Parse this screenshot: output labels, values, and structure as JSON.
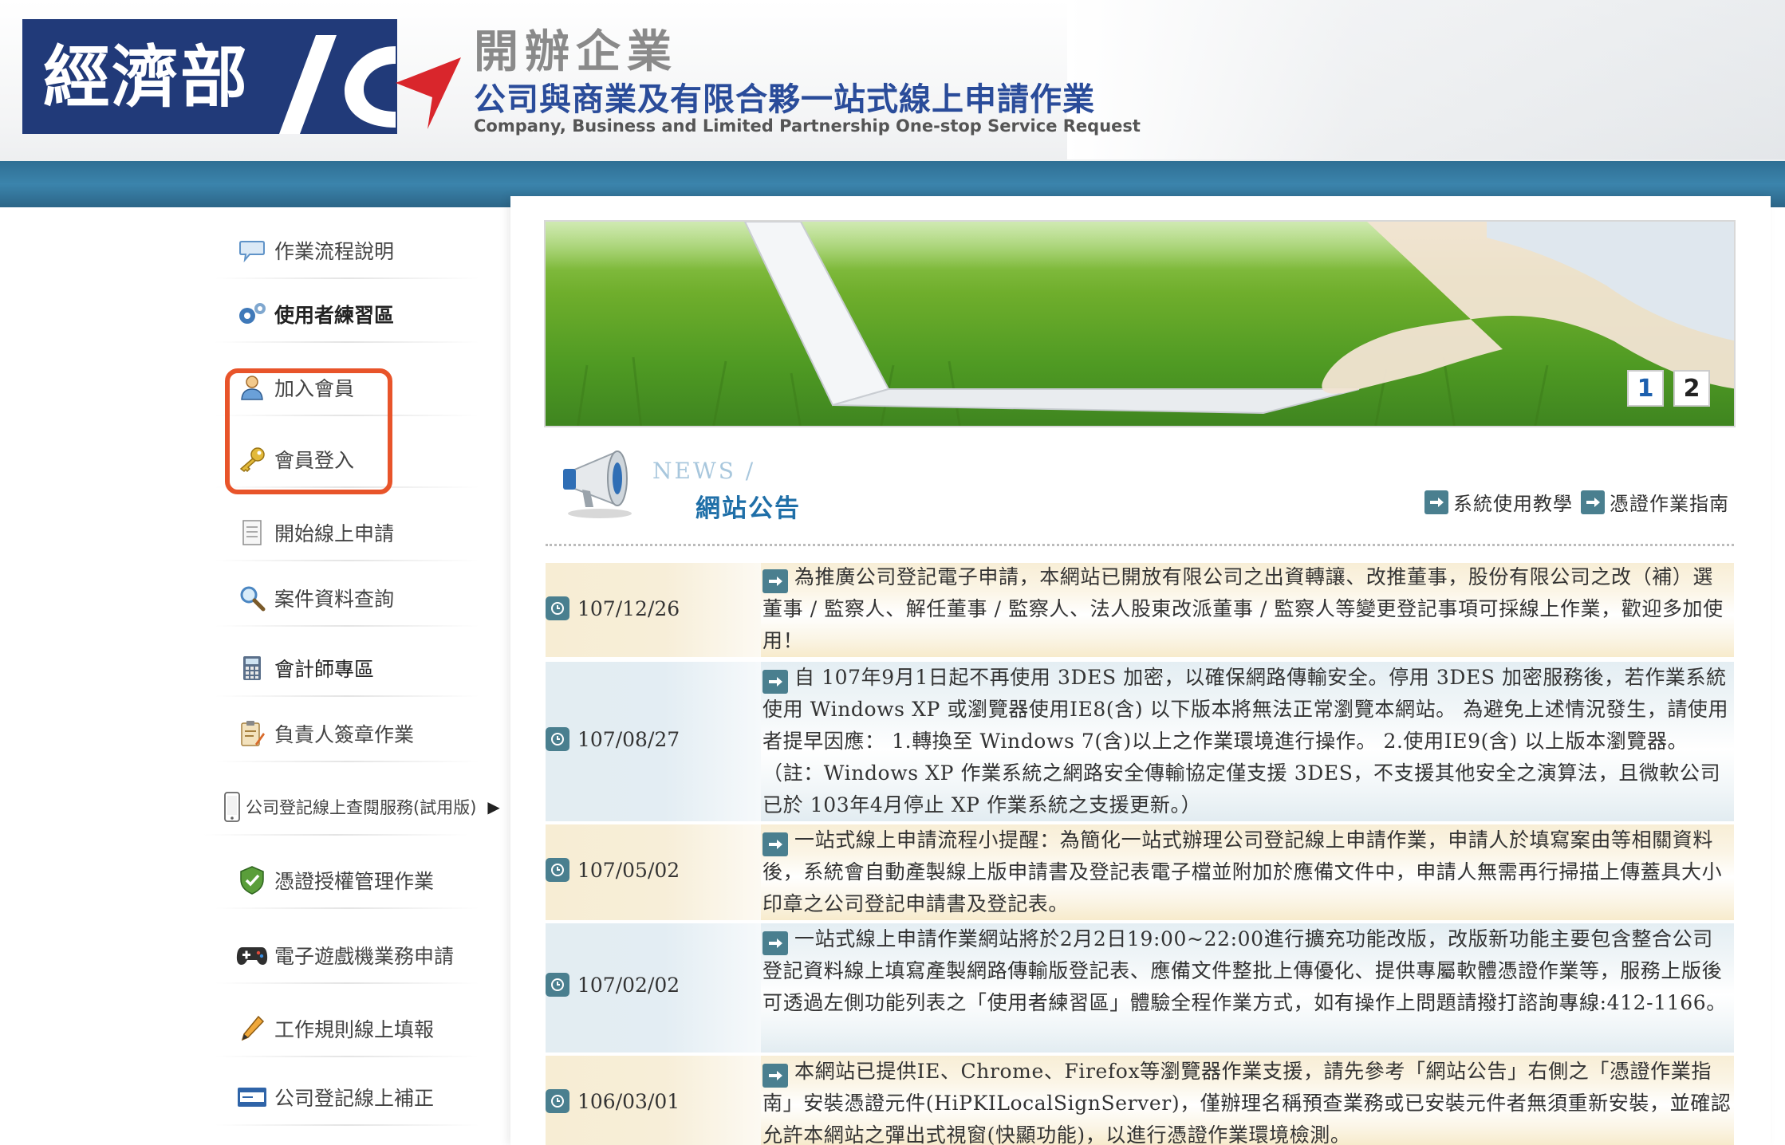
{
  "header": {
    "logo_text": "經濟部",
    "title_small": "開辦企業",
    "title_main": "公司與商業及有限合夥一站式線上申請作業",
    "title_en": "Company, Business and Limited Partnership One-stop Service Request"
  },
  "sidebar": {
    "items": [
      {
        "label": "作業流程說明",
        "icon": "speech-bubble-icon"
      },
      {
        "label": "使用者練習區",
        "icon": "gears-icon"
      },
      {
        "label": "加入會員",
        "icon": "user-icon"
      },
      {
        "label": "會員登入",
        "icon": "key-icon"
      },
      {
        "label": "開始線上申請",
        "icon": "document-icon"
      },
      {
        "label": "案件資料查詢",
        "icon": "magnifier-icon"
      },
      {
        "label": "會計師專區",
        "icon": "calculator-icon"
      },
      {
        "label": "負責人簽章作業",
        "icon": "clipboard-icon"
      },
      {
        "label": "公司登記線上查閱服務(試用版)",
        "icon": "phone-icon"
      },
      {
        "label": "憑證授權管理作業",
        "icon": "shield-icon"
      },
      {
        "label": "電子遊戲機業務申請",
        "icon": "gamepad-icon"
      },
      {
        "label": "工作規則線上填報",
        "icon": "pencil-icon"
      },
      {
        "label": "公司登記線上補正",
        "icon": "card-icon"
      }
    ]
  },
  "banner": {
    "pages": [
      "1",
      "2"
    ]
  },
  "news": {
    "small_title": "NEWS /",
    "title": "網站公告",
    "links": [
      "系統使用教學",
      "憑證作業指南"
    ],
    "items": [
      {
        "date": "107/12/26",
        "text": "為推廣公司登記電子申請，本網站已開放有限公司之出資轉讓、改推董事，股份有限公司之改（補）選董事 / 監察人、解任董事 / 監察人、法人股東改派董事 / 監察人等變更登記事項可採線上作業，歡迎多加使用！"
      },
      {
        "date": "107/08/27",
        "text": "自 107年9月1日起不再使用 3DES 加密，以確保網路傳輸安全。停用 3DES 加密服務後，若作業系統使用 Windows XP 或瀏覽器使用IE8(含) 以下版本將無法正常瀏覽本網站。 為避免上述情況發生，請使用者提早因應： 1.轉換至 Windows 7(含)以上之作業環境進行操作。 2.使用IE9(含) 以上版本瀏覽器。 （註：Windows XP 作業系統之網路安全傳輸協定僅支援 3DES，不支援其他安全之演算法，且微軟公司已於 103年4月停止 XP 作業系統之支援更新。）"
      },
      {
        "date": "107/05/02",
        "text": "一站式線上申請流程小提醒：為簡化一站式辦理公司登記線上申請作業，申請人於填寫案由等相關資料後，系統會自動產製線上版申請書及登記表電子檔並附加於應備文件中，申請人無需再行掃描上傳蓋具大小印章之公司登記申請書及登記表。"
      },
      {
        "date": "107/02/02",
        "text": "一站式線上申請作業網站將於2月2日19:00~22:00進行擴充功能改版，改版新功能主要包含整合公司登記資料線上填寫產製網路傳輸版登記表、應備文件整批上傳優化、提供專屬軟體憑證作業等，服務上版後可透過左側功能列表之「使用者練習區」體驗全程作業方式，如有操作上問題請撥打諮詢專線:412-1166。"
      },
      {
        "date": "106/03/01",
        "text": "本網站已提供IE、Chrome、Firefox等瀏覽器作業支援，請先參考「網站公告」右側之「憑證作業指南」安裝憑證元件(HiPKILocalSignServer)，僅辦理名稱預查業務或已安裝元件者無須重新安裝，並確認允許本網站之彈出式視窗(快顯功能)，以進行憑證作業環境檢測。"
      }
    ]
  },
  "colors": {
    "logo_bg": "#213a79",
    "header_bar": "#3b84ac",
    "title_blue": "#2a4c9a",
    "highlight": "#e8542a",
    "icon_teal": "#4a7f8f"
  }
}
